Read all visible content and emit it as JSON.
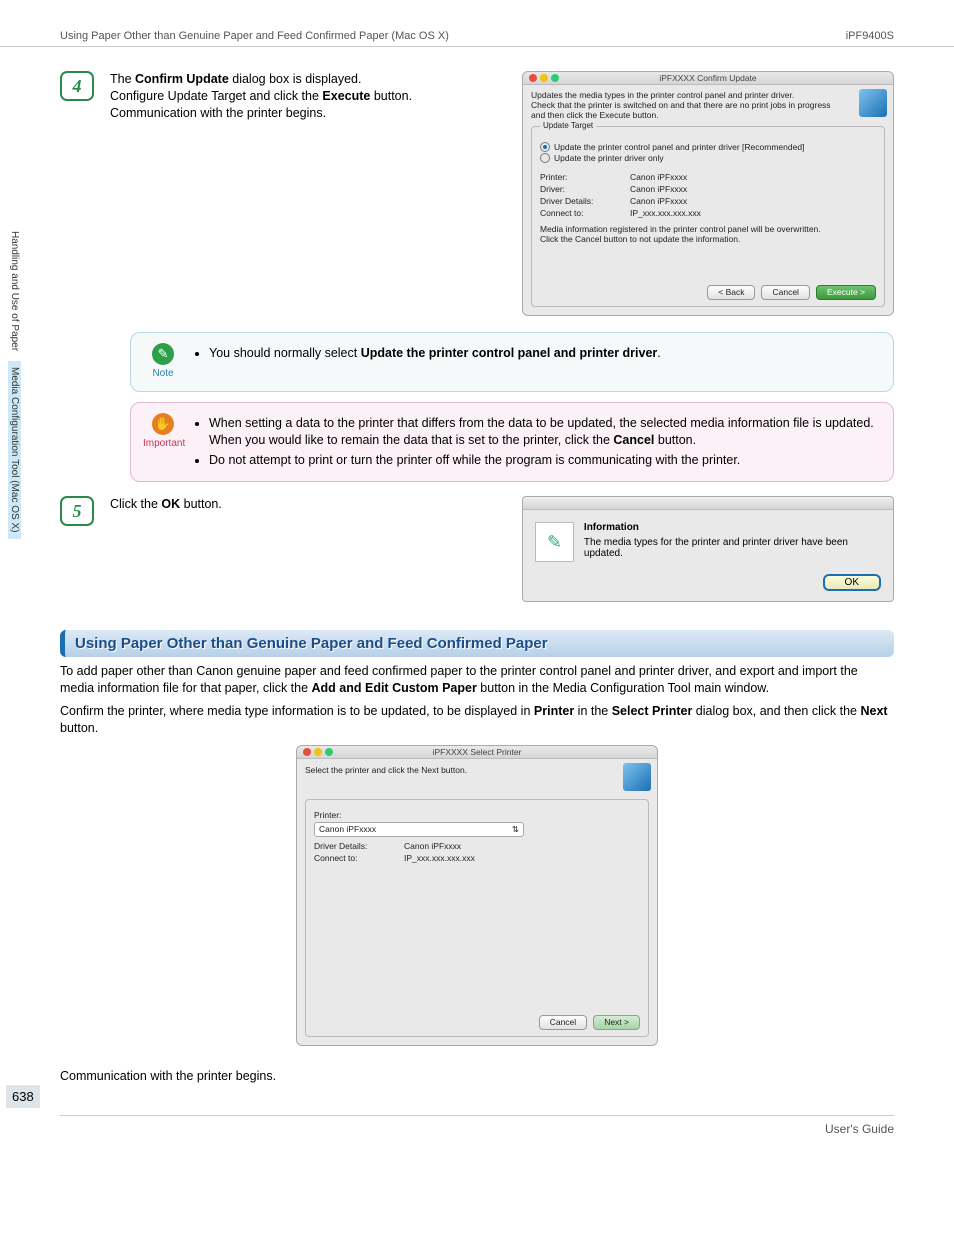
{
  "header": {
    "left": "Using Paper Other than Genuine Paper and Feed Confirmed Paper (Mac OS X)",
    "right": "iPF9400S"
  },
  "sidebar": {
    "tab1": "Handling and Use of Paper",
    "tab2": "Media Configuration Tool (Mac OS X)",
    "page": "638"
  },
  "step4": {
    "num": "4",
    "line1a": "The ",
    "line1b": "Confirm Update",
    "line1c": " dialog box is displayed.",
    "line2a": "Configure Update Target and click the ",
    "line2b": "Execute",
    "line2c": " button.",
    "line3": "Communication with the printer begins."
  },
  "dlg1": {
    "title": "iPFXXXX  Confirm Update",
    "msg1": "Updates the media types in the printer control panel and printer driver.",
    "msg2": "Check that the printer is switched on and that there are no print jobs in progress and then click the Execute button.",
    "group": "Update Target",
    "opt1": "Update the printer control panel and printer driver [Recommended]",
    "opt2": "Update the printer driver only",
    "k_printer": "Printer:",
    "v_printer": "Canon iPFxxxx",
    "k_driver": "Driver:",
    "v_driver": "Canon iPFxxxx",
    "k_details": "Driver Details:",
    "v_details": "Canon iPFxxxx",
    "k_connect": "Connect to:",
    "v_connect": "IP_xxx.xxx.xxx.xxx",
    "warn1": "Media information registered in the printer control panel will be overwritten.",
    "warn2": "Click the Cancel button to not update the information.",
    "btn_back": "< Back",
    "btn_cancel": "Cancel",
    "btn_exec": "Execute >"
  },
  "note": {
    "label": "Note",
    "t1": "You should normally select ",
    "t2": "Update the printer control panel and printer driver",
    "t3": "."
  },
  "important": {
    "label": "Important",
    "b1a": "When setting a data to the printer that differs from the data to be updated, the selected media information file is updated. When you would like to remain the data that is set to the printer, click the ",
    "b1b": "Cancel",
    "b1c": " button.",
    "b2": "Do not attempt to print or turn the printer off while the program is communicating with the printer."
  },
  "step5": {
    "num": "5",
    "t1": "Click the ",
    "t2": "OK",
    "t3": " button."
  },
  "info": {
    "title": "Information",
    "msg": "The media types for the printer and printer driver have been updated.",
    "ok": "OK"
  },
  "section": {
    "title": "Using Paper Other than Genuine Paper and Feed Confirmed Paper"
  },
  "body": {
    "p1a": "To add paper other than Canon genuine paper and feed confirmed paper to the printer control panel and printer driver, and export and import the media information file for that paper, click the ",
    "p1b": "Add and Edit Custom Paper",
    "p1c": " button in the Media Configuration Tool main window.",
    "p2a": "Confirm the printer, where media type information is to be updated, to be displayed in ",
    "p2b": "Printer",
    "p2c": " in the ",
    "p2d": "Select Printer",
    "p2e": " dialog box, and then click the ",
    "p2f": "Next",
    "p2g": " button.",
    "p3": "Communication with the printer begins."
  },
  "dlg2": {
    "title": "iPFXXXX Select Printer",
    "msg": "Select the printer and click the Next button.",
    "k_printer": "Printer:",
    "v_printer": "Canon iPFxxxx",
    "k_details": "Driver Details:",
    "v_details": "Canon iPFxxxx",
    "k_connect": "Connect to:",
    "v_connect": "IP_xxx.xxx.xxx.xxx",
    "btn_cancel": "Cancel",
    "btn_next": "Next >"
  },
  "footer": {
    "text": "User's Guide"
  }
}
